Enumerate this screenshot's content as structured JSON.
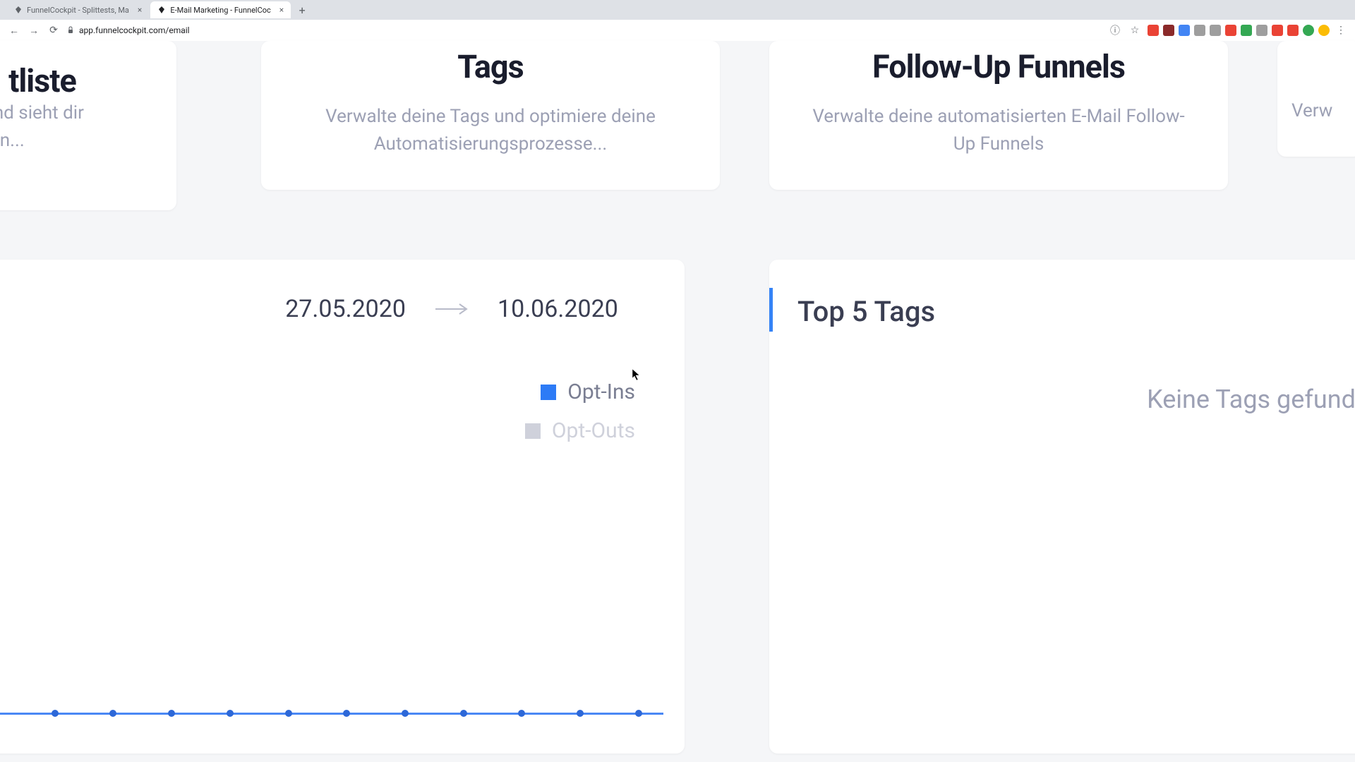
{
  "browser": {
    "tabs": [
      {
        "title": "FunnelCockpit - Splittests, Ma",
        "active": false
      },
      {
        "title": "E-Mail Marketing - FunnelCoc",
        "active": true
      }
    ],
    "url": "app.funnelcockpit.com/email"
  },
  "cards": {
    "liste": {
      "title_partial": "tliste",
      "description_partial": "ktliste und sieht dir enauer an..."
    },
    "tags": {
      "title": "Tags",
      "description": "Verwalte deine Tags und optimiere deine Automatisierungsprozesse..."
    },
    "followup": {
      "title": "Follow-Up Funnels",
      "description": "Verwalte deine automatisierten E-Mail Follow-Up Funnels"
    },
    "right_partial": {
      "description": "Verw"
    }
  },
  "chart": {
    "date_from": "27.05.2020",
    "date_to": "10.06.2020",
    "legend": {
      "opt_ins": "Opt-Ins",
      "opt_outs": "Opt-Outs"
    }
  },
  "chart_data": {
    "type": "line",
    "title": "",
    "xlabel": "",
    "ylabel": "",
    "series": [
      {
        "name": "Opt-Ins",
        "color": "#2d7bf6",
        "values": [
          0,
          0,
          0,
          0,
          0,
          0,
          0,
          0,
          0,
          0,
          0,
          0
        ]
      },
      {
        "name": "Opt-Outs",
        "color": "#cfd1db",
        "values": [
          0,
          0,
          0,
          0,
          0,
          0,
          0,
          0,
          0,
          0,
          0,
          0
        ]
      }
    ],
    "date_range": [
      "27.05.2020",
      "10.06.2020"
    ]
  },
  "top_tags": {
    "title": "Top 5 Tags",
    "empty_message": "Keine Tags gefunde"
  },
  "extension_colors": [
    "#ea4335",
    "#8b2a2a",
    "#4285f4",
    "#9e9e9e",
    "#9e9e9e",
    "#ea4335",
    "#34a853",
    "#ea4335",
    "#ea4335",
    "#34a853",
    "#fbbc04",
    "#5f6368"
  ]
}
